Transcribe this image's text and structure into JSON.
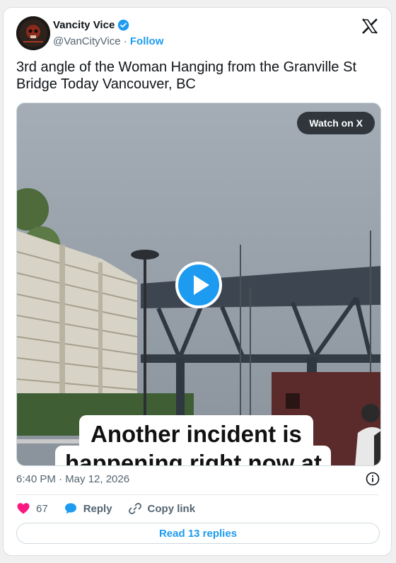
{
  "author": {
    "display_name": "Vancity Vice",
    "handle": "@VanCityVice",
    "separator": "·",
    "follow_label": "Follow"
  },
  "tweet": {
    "text": "3rd angle of the Woman Hanging from the Granville St Bridge Today Vancouver, BC",
    "timestamp": "6:40 PM · May 12, 2026"
  },
  "media": {
    "watch_label": "Watch on X",
    "caption_line1": "Another incident is",
    "caption_line2": "happening right now at"
  },
  "actions": {
    "like_count": "67",
    "reply_label": "Reply",
    "copy_link_label": "Copy link"
  },
  "footer": {
    "read_replies_label": "Read 13 replies"
  },
  "icons": {
    "verified": "verified-badge-icon",
    "brand": "x-logo-icon",
    "play": "play-icon",
    "info": "info-icon",
    "like": "heart-icon",
    "reply": "reply-bubble-icon",
    "copy": "link-icon"
  },
  "colors": {
    "accent": "#1d9bf0",
    "like": "#f91880",
    "text": "#0f1419",
    "muted": "#536471"
  }
}
